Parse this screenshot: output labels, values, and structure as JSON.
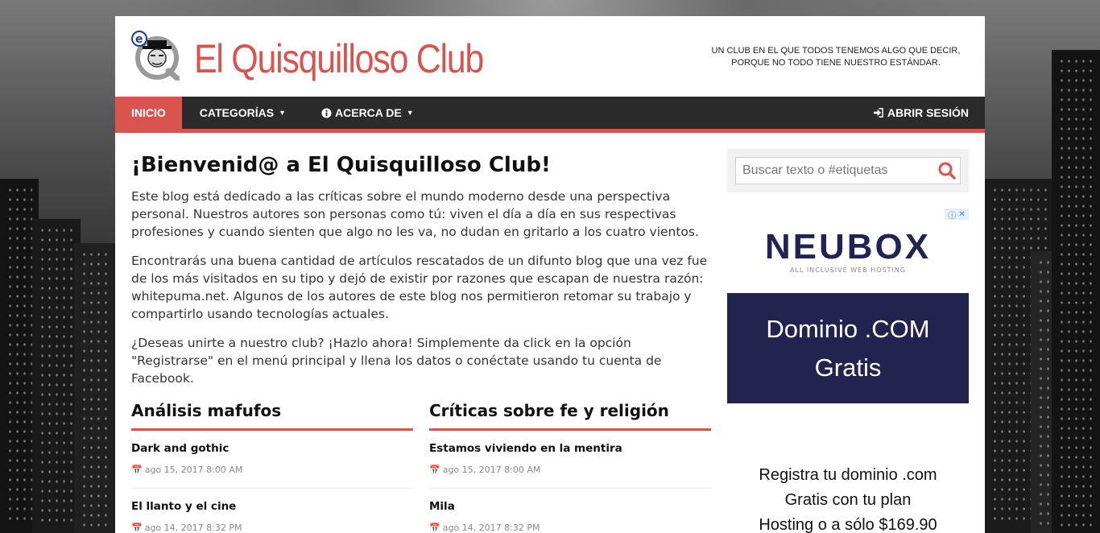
{
  "site": {
    "title": "El Quisquilloso Club",
    "tagline_line1": "UN CLUB EN EL QUE TODOS TENEMOS ALGO QUE DECIR,",
    "tagline_line2": "PORQUE NO TODO TIENE NUESTRO ESTÁNDAR."
  },
  "nav": {
    "home": "INICIO",
    "categories": "CATEGORÍAS",
    "about": "ACERCA DE",
    "login": "ABRIR SESIÓN"
  },
  "main": {
    "heading": "¡Bienvenid@ a El Quisquilloso Club!",
    "paragraphs": [
      "Este blog está dedicado a las críticas sobre el mundo moderno desde una perspectiva personal. Nuestros autores son personas como tú: viven el día a día en sus respectivas profesiones y cuando sienten que algo no les va, no dudan en gritarlo a los cuatro vientos.",
      "Encontrarás una buena cantidad de artículos rescatados de un difunto blog que una vez fue de los más visitados en su tipo y dejó de existir por razones que escapan de nuestra razón: whitepuma.net. Algunos de los autores de este blog nos permitieron retomar su trabajo y compartirlo usando tecnologías actuales.",
      "¿Deseas unirte a nuestro club? ¡Hazlo ahora! Simplemente da click en la opción \"Registrarse\" en el menú principal y llena los datos o conéctate usando tu cuenta de Facebook."
    ],
    "sections": [
      {
        "title": "Análisis mafufos",
        "posts": [
          {
            "title": "Dark and gothic",
            "date": "ago 15, 2017 8:00 AM"
          },
          {
            "title": "El llanto y el cine",
            "date": "ago 14, 2017 8:32 PM"
          }
        ]
      },
      {
        "title": "Críticas sobre fe y religión",
        "posts": [
          {
            "title": "Estamos viviendo en la mentira",
            "date": "ago 15, 2017 8:00 AM"
          },
          {
            "title": "Mila",
            "date": "ago 14, 2017 8:32 PM"
          }
        ]
      }
    ]
  },
  "sidebar": {
    "search_placeholder": "Buscar texto o #etiquetas",
    "ad": {
      "brand": "NEUBOX",
      "brand_sub": "ALL INCLUSIVE WEB HOSTING",
      "banner_line1": "Dominio .COM",
      "banner_line2": "Gratis",
      "copy_line1": "Registra tu dominio .com",
      "copy_line2": "Gratis con tu plan",
      "copy_line3": "Hosting o a sólo $169.90"
    }
  },
  "colors": {
    "accent": "#d9534f",
    "nav_bg": "#2b2b2b",
    "ad_navy": "#232350"
  }
}
